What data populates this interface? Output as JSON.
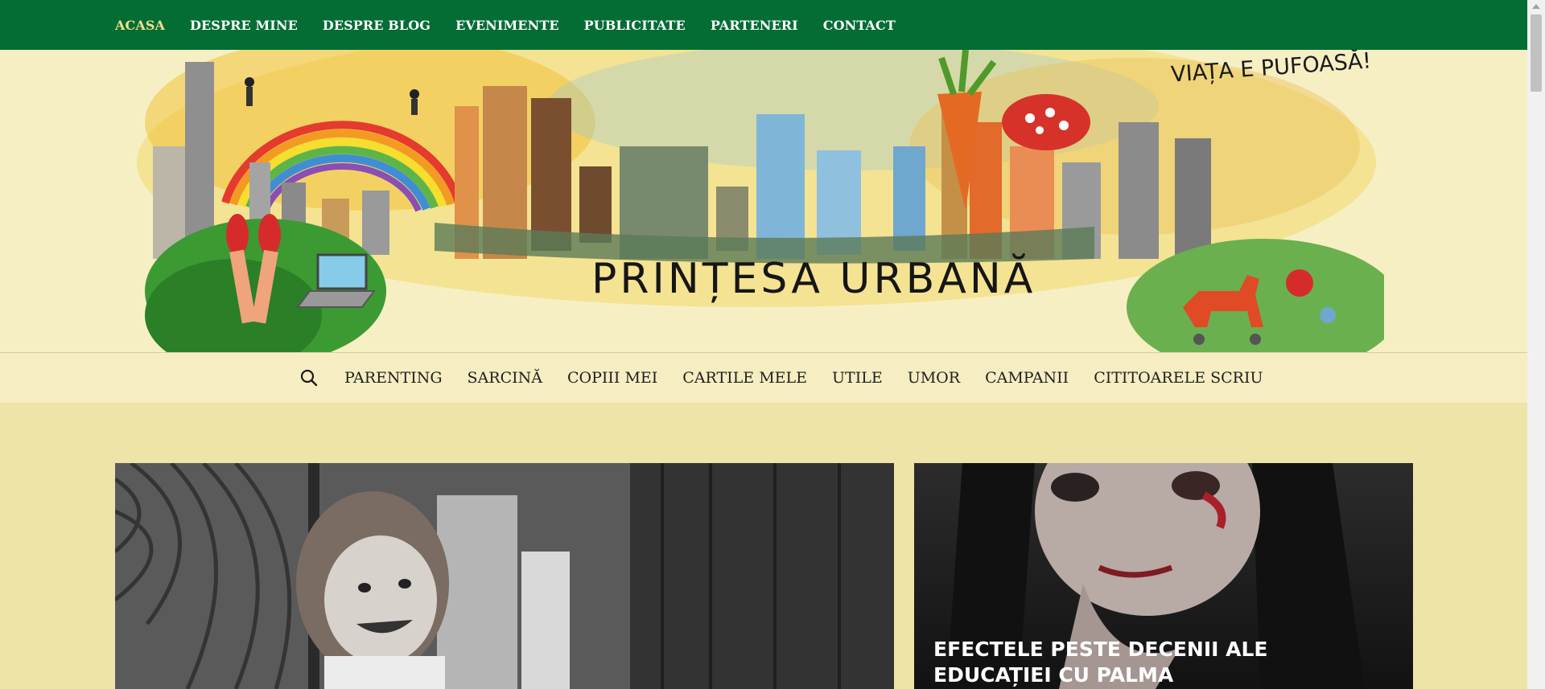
{
  "top_nav": {
    "items": [
      "ACASA",
      "DESPRE MINE",
      "DESPRE BLOG",
      "EVENIMENTE",
      "PUBLICITATE",
      "PARTENERI",
      "CONTACT"
    ],
    "active": "ACASA"
  },
  "header": {
    "site_title": "PRINȚESA URBANĂ",
    "tagline": "VIAȚA E PUFOASĂ!"
  },
  "category_nav": {
    "items": [
      "PARENTING",
      "SARCINĂ",
      "COPIII MEI",
      "CARTILE MELE",
      "UTILE",
      "UMOR",
      "CAMPANII",
      "CITITOARELE SCRIU"
    ]
  },
  "featured": {
    "right_card_title": "EFECTELE PESTE DECENII ALE EDUCAȚIEI CU PALMA"
  },
  "colors": {
    "topbar": "#046d34",
    "active_nav": "#f1e08a",
    "page_bg": "#efe4a8",
    "header_bg": "#f7efc4"
  }
}
